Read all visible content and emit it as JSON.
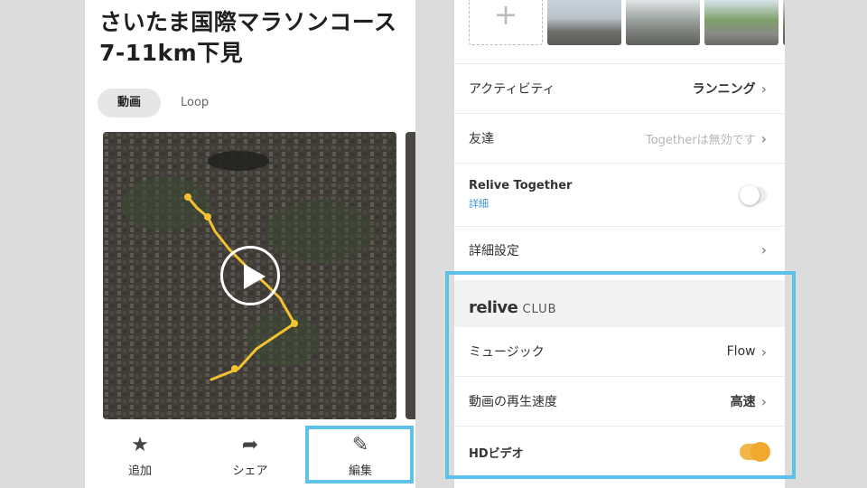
{
  "left": {
    "title": "さいたま国際マラソンコース 7-11km下見",
    "tabs": [
      {
        "label": "動画",
        "active": true
      },
      {
        "label": "Loop",
        "active": false
      }
    ],
    "actions": [
      {
        "icon": "star-icon",
        "glyph": "★",
        "label": "追加"
      },
      {
        "icon": "share-icon",
        "glyph": "➦",
        "label": "シェア"
      },
      {
        "icon": "pencil-icon",
        "glyph": "✎",
        "label": "編集"
      }
    ]
  },
  "right": {
    "add_photo_glyph": "+",
    "rows": {
      "activity": {
        "label": "アクティビティ",
        "value": "ランニング"
      },
      "friends": {
        "label": "友達",
        "value": "Togetherは無効です"
      },
      "together": {
        "label": "Relive Together",
        "link": "詳細",
        "enabled": false
      },
      "advanced": {
        "label": "詳細設定"
      }
    },
    "club": {
      "logo": "relive",
      "tag": "CLUB",
      "music": {
        "label": "ミュージック",
        "value": "Flow"
      },
      "speed": {
        "label": "動画の再生速度",
        "value": "高速"
      },
      "hd": {
        "label": "HDビデオ",
        "enabled": true
      }
    },
    "chevron": "›"
  },
  "colors": {
    "highlight": "#5ec1ea",
    "toggle_on": "#f0a92e",
    "link": "#3a9ad9",
    "route": "#f2c230"
  }
}
